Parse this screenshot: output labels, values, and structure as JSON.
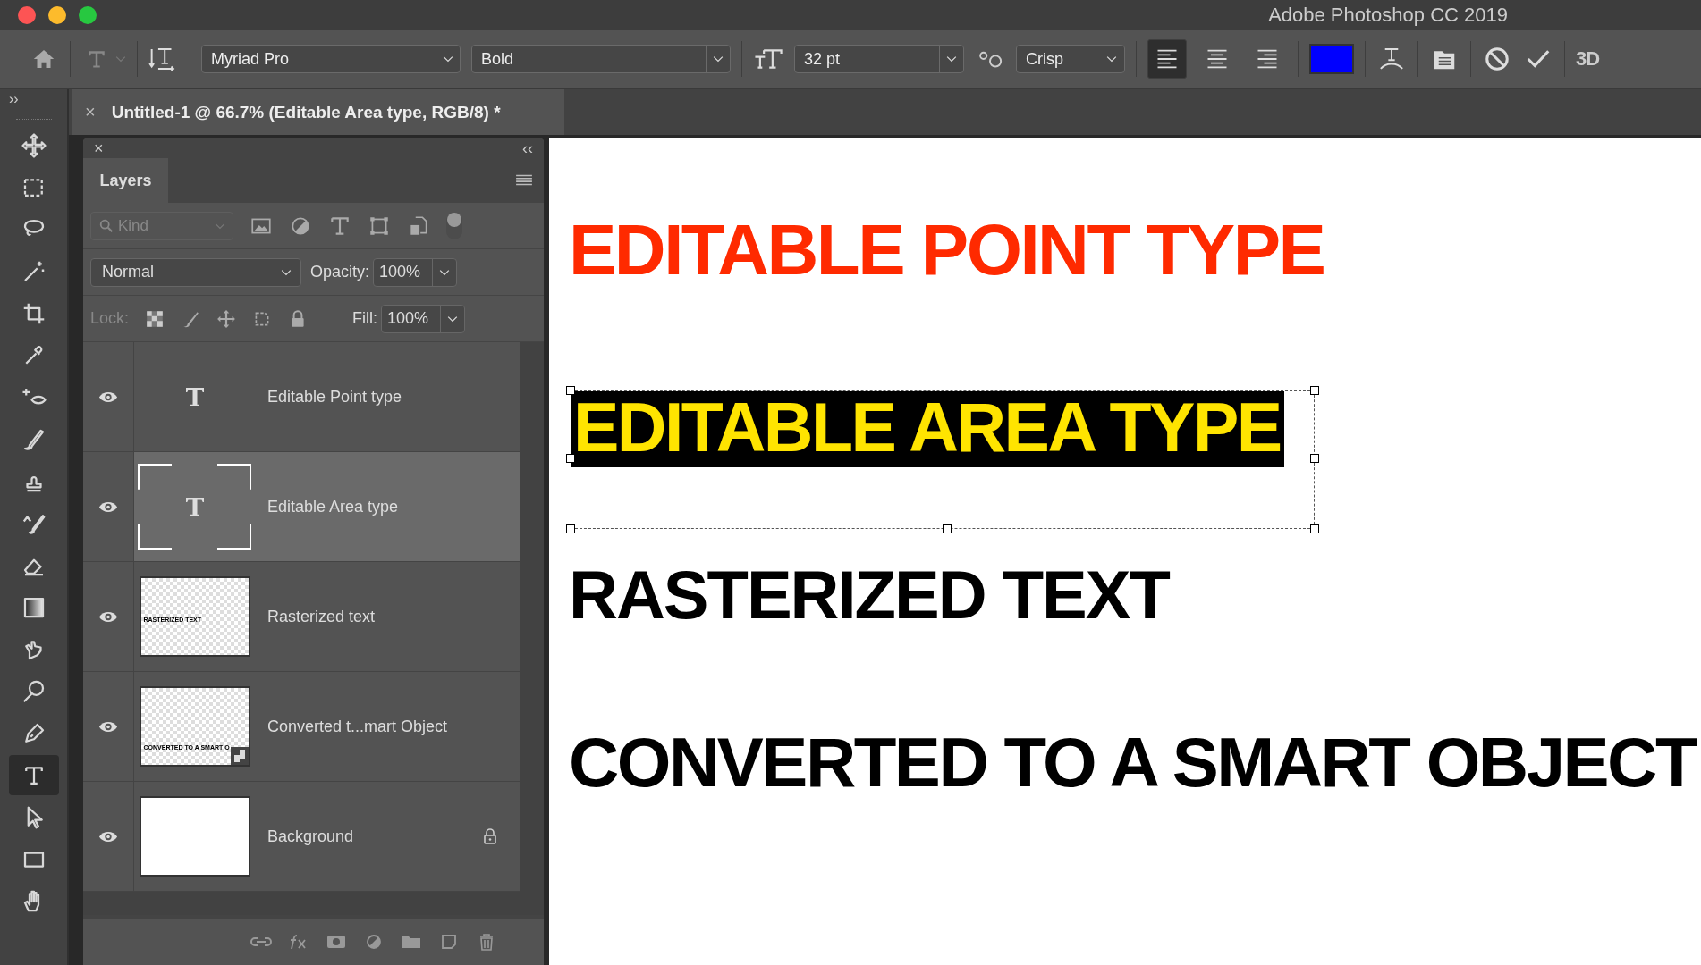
{
  "window": {
    "title": "Adobe Photoshop CC 2019"
  },
  "options_bar": {
    "font_family": "Myriad Pro",
    "font_style": "Bold",
    "font_size": "32 pt",
    "antialias": "Crisp",
    "alignments": [
      {
        "selected": true
      },
      {
        "selected": false
      },
      {
        "selected": false
      }
    ],
    "color_swatch": {
      "color": "#0000ff"
    },
    "three_d": "3D"
  },
  "tools_expand": "››",
  "tools": [
    {
      "selected": false
    },
    {
      "selected": false
    },
    {
      "selected": false
    },
    {
      "selected": false
    },
    {
      "selected": false
    },
    {
      "selected": false
    },
    {
      "selected": false
    },
    {
      "selected": false
    },
    {
      "selected": false
    },
    {
      "selected": false
    },
    {
      "selected": false
    },
    {
      "selected": false
    },
    {
      "selected": false
    },
    {
      "selected": false
    },
    {
      "selected": false
    },
    {
      "selected": true
    },
    {
      "selected": false
    },
    {
      "selected": false
    },
    {
      "selected": false
    }
  ],
  "document_tab": {
    "close": "×",
    "title": "Untitled-1 @ 66.7% (Editable Area type, RGB/8) *"
  },
  "layers_panel": {
    "close": "×",
    "collapse": "‹‹",
    "tab": "Layers",
    "filter_placeholder": "Kind",
    "blend_mode": "Normal",
    "opacity_label": "Opacity:",
    "opacity": "100%",
    "lock_label": "Lock:",
    "fill_label": "Fill:",
    "fill": "100%",
    "layers": [
      {
        "name": "Editable Point type",
        "kind": "text",
        "visible": true,
        "selected": false,
        "locked": false
      },
      {
        "name": "Editable Area type",
        "kind": "area-text",
        "visible": true,
        "selected": true,
        "locked": false
      },
      {
        "name": "Rasterized text",
        "kind": "raster",
        "thumb_text": "RASTERIZED TEXT",
        "visible": true,
        "selected": false,
        "locked": false
      },
      {
        "name": "Converted t...mart Object",
        "kind": "smart",
        "thumb_text": "CONVERTED TO A SMART O",
        "visible": true,
        "selected": false,
        "locked": false
      },
      {
        "name": "Background",
        "kind": "fill",
        "visible": true,
        "selected": false,
        "locked": true
      }
    ]
  },
  "canvas": {
    "items": [
      {
        "text": "EDITABLE POINT TYPE",
        "kind": "point",
        "color": "#ff2a00"
      },
      {
        "text": "EDITABLE AREA TYPE",
        "kind": "area",
        "color": "#ffe400",
        "selected": true
      },
      {
        "text": "RASTERIZED TEXT",
        "kind": "raster",
        "color": "#000000"
      },
      {
        "text": "CONVERTED TO A SMART OBJECT",
        "kind": "smart",
        "color": "#000000"
      }
    ]
  }
}
